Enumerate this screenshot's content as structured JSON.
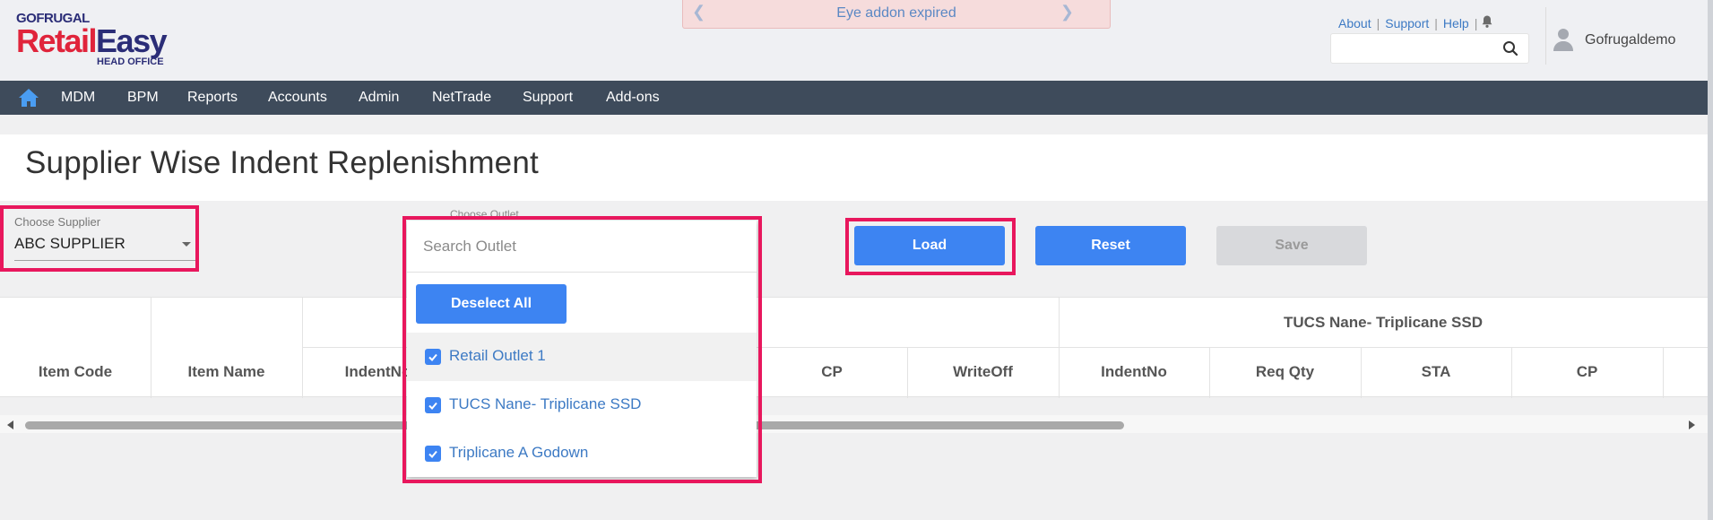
{
  "brand": {
    "top": "GOFRUGAL",
    "main_red": "Retail",
    "main_blue": "Easy",
    "sub": "HEAD OFFICE"
  },
  "notice": {
    "text": "Eye addon expired"
  },
  "top_links": {
    "about": "About",
    "support": "Support",
    "help": "Help"
  },
  "search": {
    "value": "",
    "placeholder": ""
  },
  "user": {
    "name": "Gofrugaldemo"
  },
  "nav": [
    "MDM",
    "BPM",
    "Reports",
    "Accounts",
    "Admin",
    "NetTrade",
    "Support",
    "Add-ons"
  ],
  "page": {
    "title": "Supplier Wise Indent Replenishment"
  },
  "supplier": {
    "label": "Choose Supplier",
    "value": "ABC SUPPLIER"
  },
  "outlet": {
    "label": "Choose Outlet",
    "search_placeholder": "Search Outlet",
    "deselect_label": "Deselect All",
    "options": [
      {
        "label": "Retail Outlet 1",
        "checked": true
      },
      {
        "label": "TUCS Nane- Triplicane SSD",
        "checked": true
      },
      {
        "label": "Triplicane A Godown",
        "checked": true
      }
    ]
  },
  "buttons": {
    "load": "Load",
    "reset": "Reset",
    "save": "Save"
  },
  "table": {
    "group_header": "TUCS Nane- Triplicane SSD",
    "columns": {
      "item_code": "Item Code",
      "item_name": "Item Name",
      "indent_no_1": "IndentNo",
      "cp_1": "CP",
      "write_off": "WriteOff",
      "indent_no_2": "IndentNo",
      "req_qty": "Req Qty",
      "sta": "STA",
      "cp_2": "CP"
    }
  },
  "colors": {
    "accent": "#3d84f2",
    "highlight": "#e8175d",
    "nav_bg": "#3e4b5b",
    "notice_bg": "#f6dcdc"
  }
}
